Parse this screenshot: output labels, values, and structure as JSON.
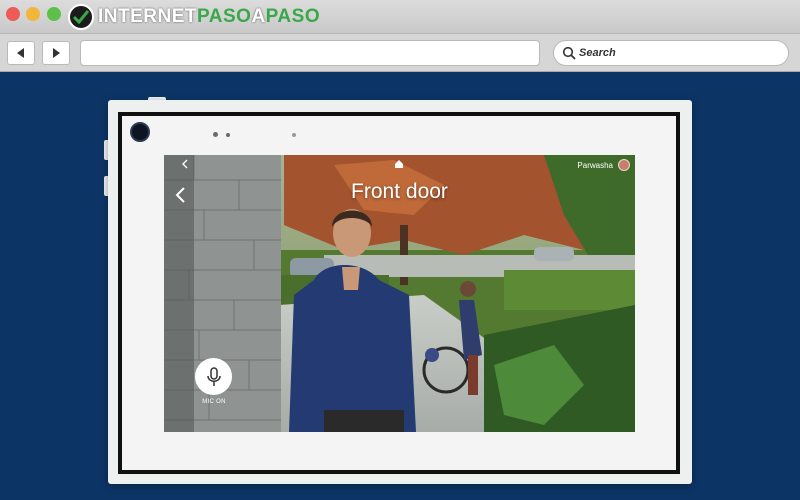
{
  "browser": {
    "site_brand": {
      "part1": "INTERNET",
      "part2": "PASO",
      "part3": "A",
      "part4": "PASO"
    },
    "url": "",
    "search": {
      "placeholder": "Search"
    }
  },
  "device_screen": {
    "title": "Front door",
    "user_name": "Parwasha",
    "mic_label": "MIC ON",
    "icons": [
      "back-chevron-icon",
      "small-back-chevron-icon",
      "home-icon",
      "microphone-icon",
      "user-avatar"
    ]
  },
  "colors": {
    "page_background": "#0c3566",
    "device_bezel": "#eef0ef",
    "frame": "#101010",
    "brand_green": "#3aa84a"
  }
}
